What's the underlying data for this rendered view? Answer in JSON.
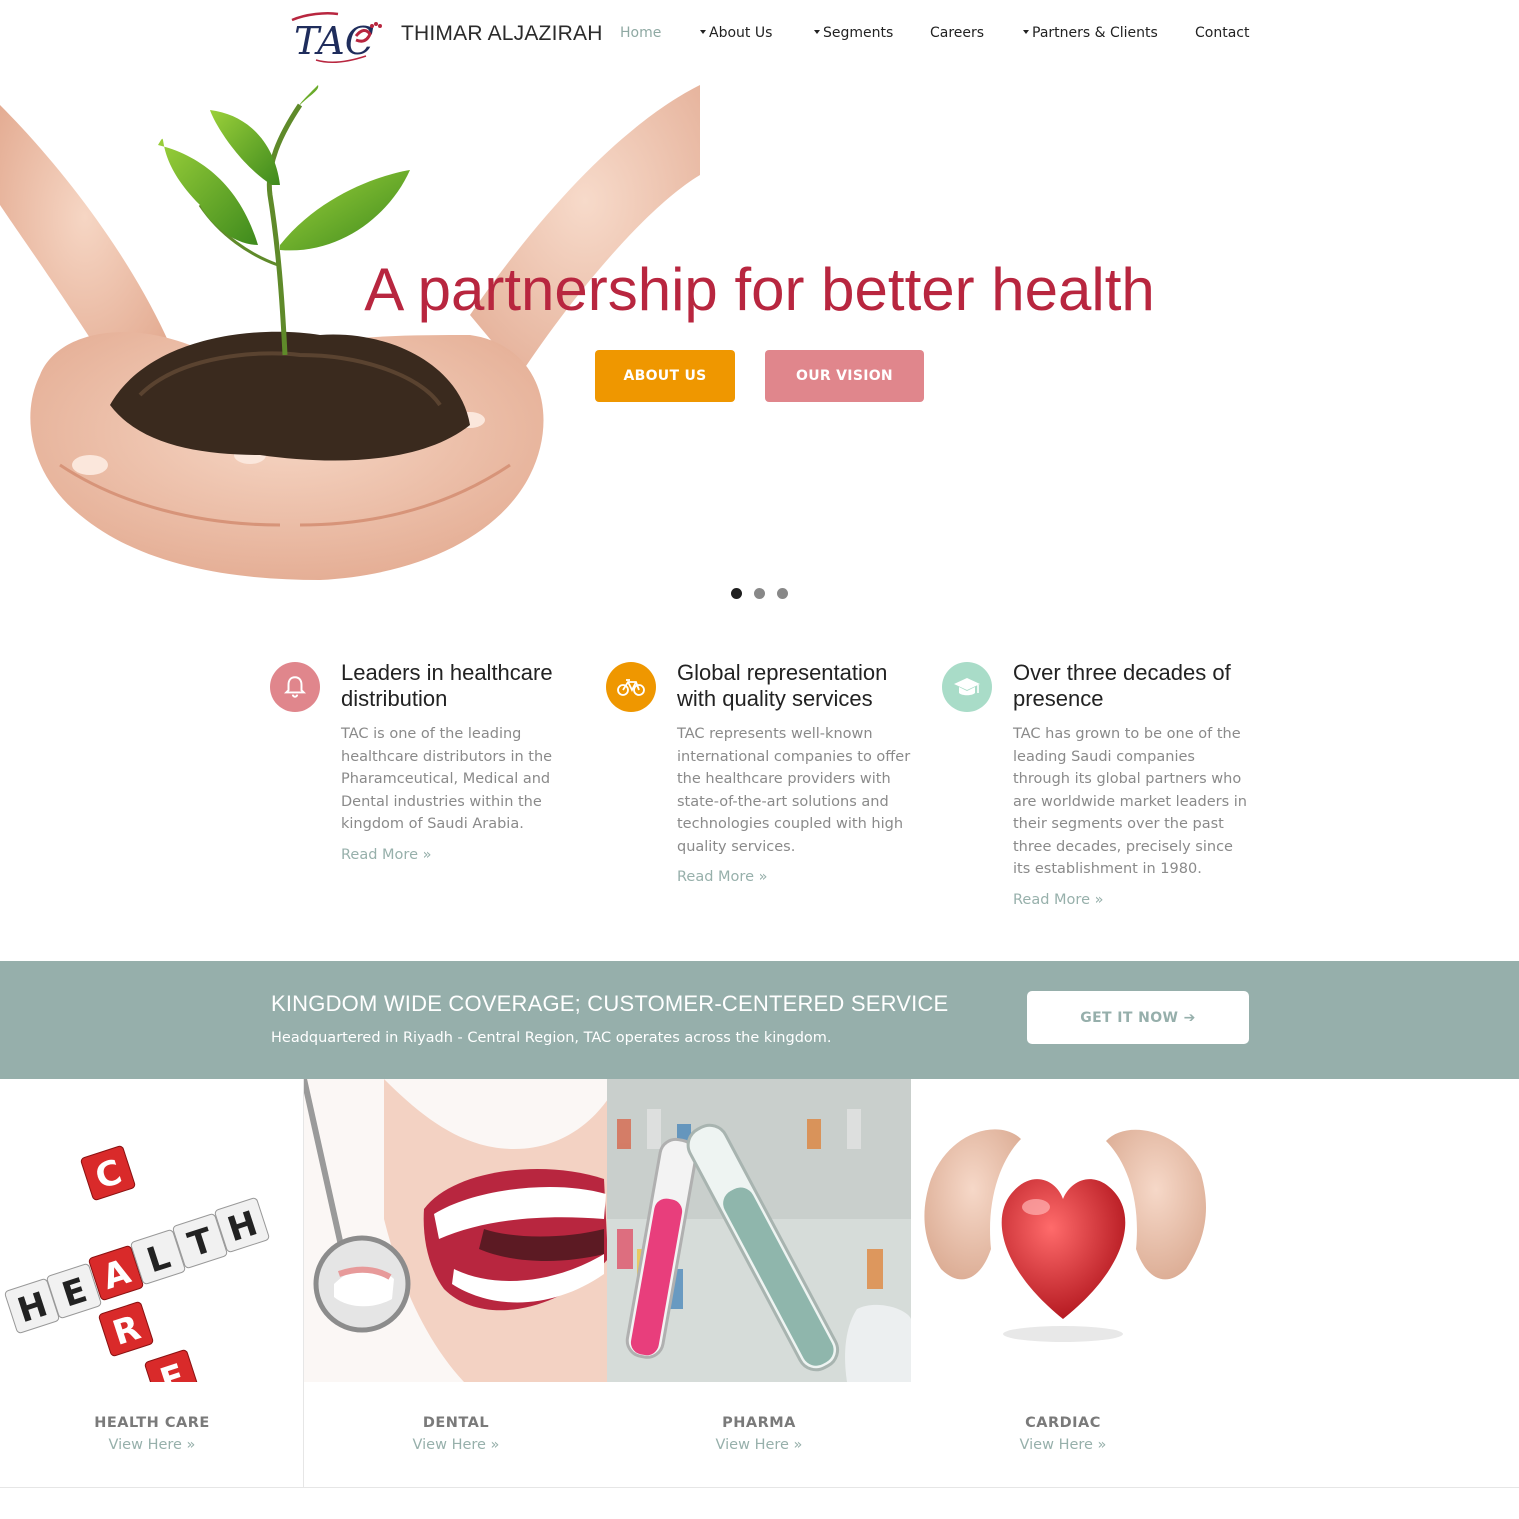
{
  "header": {
    "brand_name": "THIMAR ALJAZIRAH",
    "logo_text": "TAC",
    "nav": [
      {
        "label": "Home",
        "active": true,
        "dropdown": false
      },
      {
        "label": "About Us",
        "active": false,
        "dropdown": true
      },
      {
        "label": "Segments",
        "active": false,
        "dropdown": true
      },
      {
        "label": "Careers",
        "active": false,
        "dropdown": false
      },
      {
        "label": "Partners & Clients",
        "active": false,
        "dropdown": true
      },
      {
        "label": "Contact",
        "active": false,
        "dropdown": false
      }
    ]
  },
  "hero": {
    "title": "A partnership for better health",
    "buttons": {
      "about": "ABOUT US",
      "vision": "OUR VISION"
    },
    "slides": {
      "count": 3,
      "active": 1
    }
  },
  "features": [
    {
      "icon": "bell-icon",
      "color": "#e0868c",
      "title": "Leaders in healthcare distribution",
      "text": "TAC is one of the leading healthcare distributors in the Pharamceutical, Medical and Dental industries within the kingdom of Saudi Arabia.",
      "link": "Read More »"
    },
    {
      "icon": "bicycle-icon",
      "color": "#ef9700",
      "title": "Global representation with quality services",
      "text": "TAC represents well-known international companies to offer the healthcare providers with state-of-the-art solutions and technologies coupled with high quality services.",
      "link": "Read More »"
    },
    {
      "icon": "graduation-cap-icon",
      "color": "#a9dcc8",
      "title": "Over three decades of presence",
      "text": "TAC has grown to be one of the leading Saudi companies through its global partners who are worldwide market leaders in their segments over the past three decades, precisely since its establishment in 1980.",
      "link": "Read More »"
    }
  ],
  "banner": {
    "title": "KINGDOM WIDE COVERAGE; CUSTOMER-CENTERED SERVICE",
    "subtitle": "Headquartered in Riyadh - Central Region, TAC operates across the kingdom.",
    "button": "GET IT NOW ➔"
  },
  "segments": [
    {
      "label": "HEALTH CARE",
      "link": "View Here »",
      "image_letters": [
        "H",
        "E",
        "A",
        "L",
        "T",
        "H",
        "C",
        "A",
        "R",
        "E"
      ]
    },
    {
      "label": "DENTAL",
      "link": "View Here »"
    },
    {
      "label": "PHARMA",
      "link": "View Here »"
    },
    {
      "label": "CARDIAC",
      "link": "View Here »"
    }
  ],
  "colors": {
    "accent_red": "#b8263f",
    "orange": "#ef9700",
    "pink": "#e0868c",
    "mint": "#a9dcc8",
    "sage": "#96afab"
  }
}
